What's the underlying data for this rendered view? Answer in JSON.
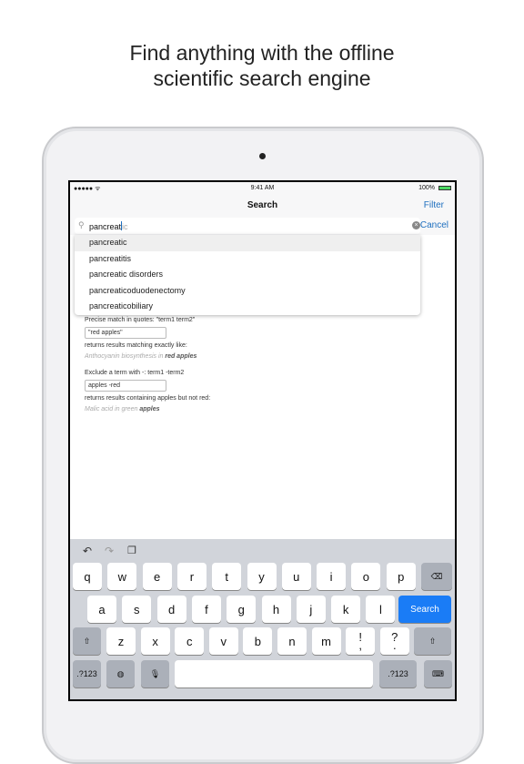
{
  "headline": [
    "Find anything with the offline",
    "scientific search engine"
  ],
  "status": {
    "signal": "●●●●● ᯤ",
    "time": "9:41 AM",
    "battery": "100%"
  },
  "nav": {
    "title": "Search",
    "filter": "Filter"
  },
  "search": {
    "typed": "pancreat",
    "suggestion_suffix": "ic",
    "cancel": "Cancel"
  },
  "suggestions": [
    "pancreatic",
    "pancreatitis",
    "pancreatic disorders",
    "pancreaticoduodenectomy",
    "pancreaticobiliary"
  ],
  "help": {
    "precise_label": "Precise match in quotes: \"term1 term2\"",
    "precise_example": "\"red apples\"",
    "precise_returns": "returns results matching exactly like:",
    "precise_result_plain": "Anthocyanin biosynthesis in ",
    "precise_result_bold": "red apples",
    "exclude_label": "Exclude a term with -: term1 -term2",
    "exclude_example": "apples -red",
    "exclude_returns": "returns results containing apples but not red:",
    "exclude_result_plain": "Malic acid in green ",
    "exclude_result_bold": "apples"
  },
  "keyboard": {
    "row1": [
      "q",
      "w",
      "e",
      "r",
      "t",
      "y",
      "u",
      "i",
      "o",
      "p"
    ],
    "row2": [
      "a",
      "s",
      "d",
      "f",
      "g",
      "h",
      "j",
      "k",
      "l"
    ],
    "row3": [
      "z",
      "x",
      "c",
      "v",
      "b",
      "n",
      "m",
      "!\n,",
      "?\n."
    ],
    "search": "Search",
    "numbers": ".?123"
  },
  "colors": {
    "accent": "#1a7cf6",
    "link": "#1e6fbf"
  }
}
